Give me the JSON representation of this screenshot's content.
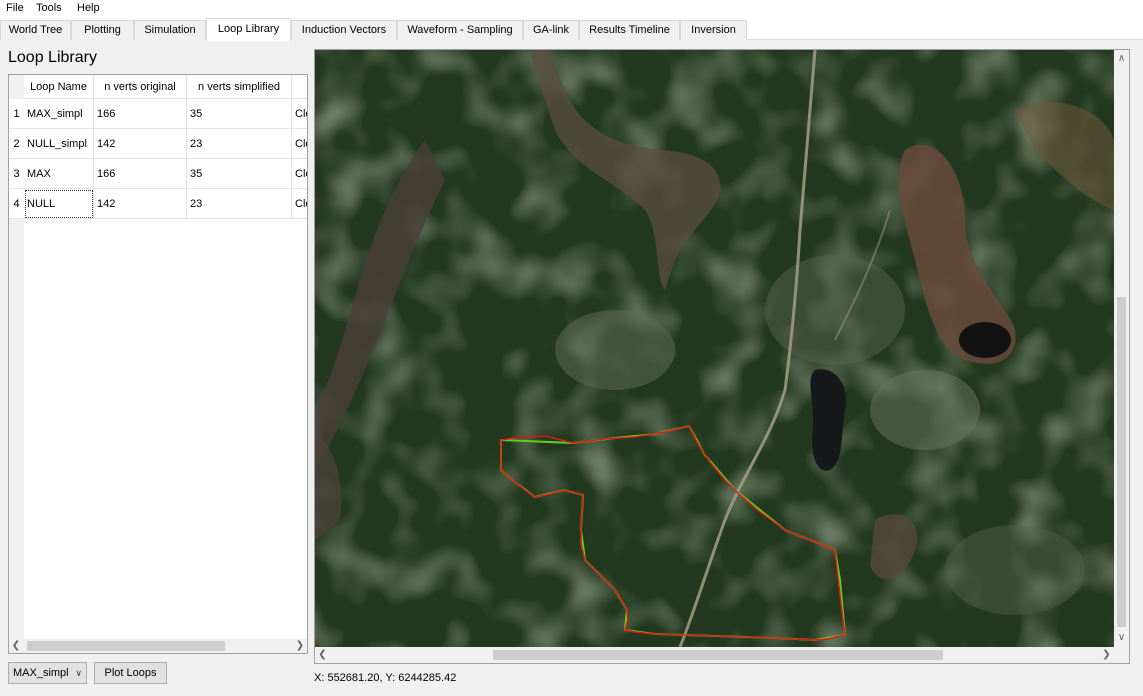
{
  "menu": {
    "file": "File",
    "tools": "Tools",
    "help": "Help"
  },
  "tabs": [
    {
      "label": "World Tree"
    },
    {
      "label": "Plotting"
    },
    {
      "label": "Simulation"
    },
    {
      "label": "Loop Library"
    },
    {
      "label": "Induction Vectors"
    },
    {
      "label": "Waveform - Sampling"
    },
    {
      "label": "GA-link"
    },
    {
      "label": "Results Timeline"
    },
    {
      "label": "Inversion"
    }
  ],
  "active_tab": "Loop Library",
  "panel": {
    "title": "Loop Library"
  },
  "table": {
    "columns": [
      "Loop Name",
      "n verts original",
      "n verts simplified",
      ""
    ],
    "rows": [
      {
        "num": "1",
        "name": "MAX_simpl",
        "orig": "166",
        "simp": "35",
        "extra": "Clo"
      },
      {
        "num": "2",
        "name": "NULL_simpl",
        "orig": "142",
        "simp": "23",
        "extra": "Clo"
      },
      {
        "num": "3",
        "name": "MAX",
        "orig": "166",
        "simp": "35",
        "extra": "Clo"
      },
      {
        "num": "4",
        "name": "NULL",
        "orig": "142",
        "simp": "23",
        "extra": "Clo"
      }
    ]
  },
  "controls": {
    "loop_select": "MAX_simpl",
    "plot_button": "Plot Loops"
  },
  "status": {
    "coords": "X: 552681.20, Y: 6244285.42"
  },
  "colors": {
    "loop_outline": "#e0161a",
    "loop_simplified": "#5ad21e"
  }
}
